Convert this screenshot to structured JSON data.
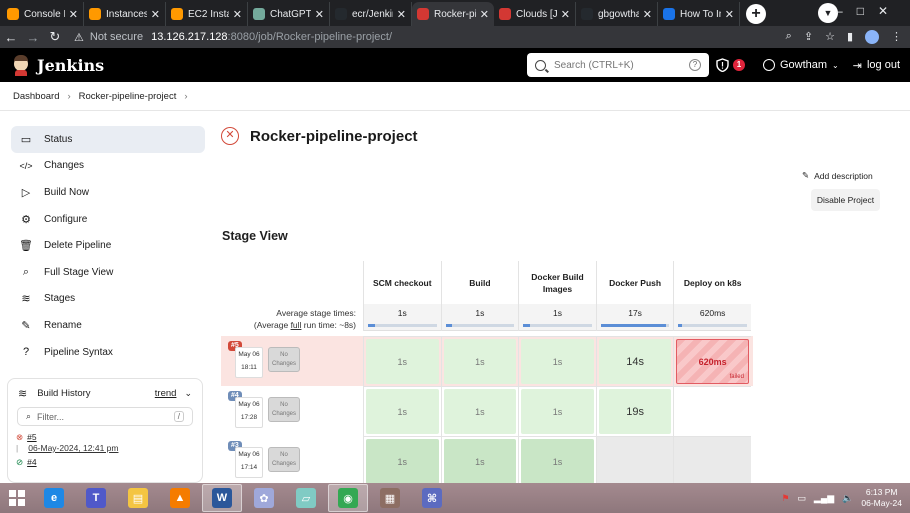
{
  "browser": {
    "tabs": [
      {
        "title": "Console Ho",
        "color": "#ff9900"
      },
      {
        "title": "Instances |",
        "color": "#ff9900"
      },
      {
        "title": "EC2 Instanc",
        "color": "#ff9900"
      },
      {
        "title": "ChatGPT",
        "color": "#74aa9c"
      },
      {
        "title": "ecr/Jenkins",
        "color": "#24292e"
      },
      {
        "title": "Rocker-pip",
        "color": "#d33833",
        "active": true
      },
      {
        "title": "Clouds [Jen",
        "color": "#d33833"
      },
      {
        "title": "gbgowthar",
        "color": "#24292e"
      },
      {
        "title": "How To Ins",
        "color": "#1a73e8"
      }
    ],
    "url_warning": "Not secure",
    "url_host": "13.126.217.128",
    "url_path": ":8080/job/Rocker-pipeline-project/"
  },
  "jenkins": {
    "brand": "Jenkins",
    "search_placeholder": "Search (CTRL+K)",
    "help_glyph": "?",
    "security_count": "1",
    "user": "Gowtham",
    "logout": "log out"
  },
  "breadcrumb": [
    "Dashboard",
    "Rocker-pipeline-project"
  ],
  "sidebar": {
    "items": [
      {
        "label": "Status",
        "icon": "status-icon",
        "glyph": "▭"
      },
      {
        "label": "Changes",
        "icon": "code-icon",
        "glyph": "</>"
      },
      {
        "label": "Build Now",
        "icon": "play-icon",
        "glyph": "▷"
      },
      {
        "label": "Configure",
        "icon": "gear-icon",
        "glyph": "⚙"
      },
      {
        "label": "Delete Pipeline",
        "icon": "trash-icon",
        "glyph": "🗑"
      },
      {
        "label": "Full Stage View",
        "icon": "search-icon",
        "glyph": "⌕"
      },
      {
        "label": "Stages",
        "icon": "layers-icon",
        "glyph": "≋"
      },
      {
        "label": "Rename",
        "icon": "pencil-icon",
        "glyph": "✎"
      },
      {
        "label": "Pipeline Syntax",
        "icon": "help-icon",
        "glyph": "?"
      }
    ],
    "build_history": {
      "title": "Build History",
      "trend": "trend",
      "filter_placeholder": "Filter...",
      "filter_shortcut": "/",
      "builds": [
        {
          "number": "#5",
          "date": "06-May-2024, 12:41 pm",
          "status": "failed"
        },
        {
          "number": "#4",
          "date": "",
          "status": "success"
        }
      ]
    }
  },
  "main": {
    "title": "Rocker-pipeline-project",
    "add_description": "Add description",
    "disable_project": "Disable Project",
    "stage_view_title": "Stage View",
    "avg_label_line1": "Average stage times:",
    "avg_label_prefix": "(Average ",
    "avg_label_link": "full",
    "avg_label_suffix": " run time: ~8s)",
    "stages": [
      "SCM checkout",
      "Build",
      "Docker Build Images",
      "Docker Push",
      "Deploy on k8s"
    ],
    "avg_times": [
      "1s",
      "1s",
      "1s",
      "17s",
      "620ms"
    ],
    "avg_fill": [
      0.1,
      0.1,
      0.1,
      0.95,
      0.05
    ],
    "builds": [
      {
        "number": "#5",
        "badge_color": "#d24939",
        "month_day": "May 06",
        "time": "18:11",
        "no_changes": "No Changes",
        "failed": true,
        "cells": [
          "1s",
          "1s",
          "1s",
          "14s",
          "620ms"
        ],
        "cell_state": [
          "ok",
          "ok",
          "ok",
          "ok",
          "fail"
        ],
        "fail_tag": "failed"
      },
      {
        "number": "#4",
        "badge_color": "#6f8db8",
        "month_day": "May 06",
        "time": "17:28",
        "no_changes": "No Changes",
        "failed": false,
        "cells": [
          "1s",
          "1s",
          "1s",
          "19s",
          ""
        ],
        "cell_state": [
          "ok",
          "ok",
          "ok",
          "ok",
          "empty"
        ]
      },
      {
        "number": "#3",
        "badge_color": "#6f8db8",
        "month_day": "May 06",
        "time": "17:14",
        "no_changes": "No Changes",
        "failed": false,
        "cells": [
          "1s",
          "1s",
          "1s",
          "",
          ""
        ],
        "cell_state": [
          "ok",
          "ok",
          "ok",
          "empty",
          "empty"
        ]
      }
    ]
  },
  "taskbar": {
    "apps": [
      "internet-explorer",
      "teams",
      "file-explorer",
      "vlc",
      "word",
      "paint",
      "notepad",
      "chrome",
      "archive",
      "network"
    ],
    "time": "6:13 PM",
    "date": "06-May-24"
  }
}
